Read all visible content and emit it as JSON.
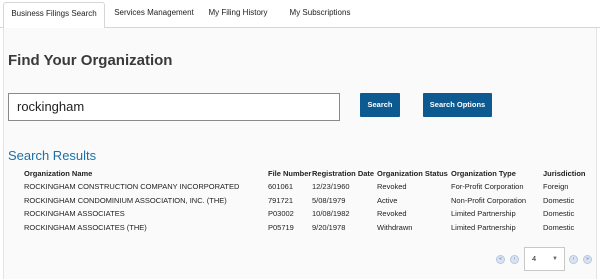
{
  "tabs": [
    {
      "label": "Business Filings Search",
      "active": true
    },
    {
      "label": "Services Management",
      "active": false
    },
    {
      "label": "My Filing History",
      "active": false
    },
    {
      "label": "My Subscriptions",
      "active": false
    }
  ],
  "heading": "Find Your Organization",
  "search": {
    "value": "rockingham"
  },
  "buttons": {
    "search": "Search",
    "options": "Search Options"
  },
  "results": {
    "title": "Search Results",
    "columns": [
      "Organization Name",
      "File Number",
      "Registration Date",
      "Organization Status",
      "Organization Type",
      "Jurisdiction"
    ],
    "rows": [
      [
        "ROCKINGHAM CONSTRUCTION COMPANY INCORPORATED",
        "601061",
        "12/23/1960",
        "Revoked",
        "For-Profit Corporation",
        "Foreign"
      ],
      [
        "ROCKINGHAM CONDOMINIUM ASSOCIATION, INC. (THE)",
        "791721",
        "5/08/1979",
        "Active",
        "Non-Profit Corporation",
        "Domestic"
      ],
      [
        "ROCKINGHAM ASSOCIATES",
        "P03002",
        "10/08/1982",
        "Revoked",
        "Limited Partnership",
        "Domestic"
      ],
      [
        "ROCKINGHAM ASSOCIATES (THE)",
        "P05719",
        "9/20/1978",
        "Withdrawn",
        "Limited Partnership",
        "Domestic"
      ]
    ]
  },
  "pagination": {
    "page": "4",
    "first": "«",
    "prev": "‹",
    "next": "›",
    "last": "»"
  }
}
